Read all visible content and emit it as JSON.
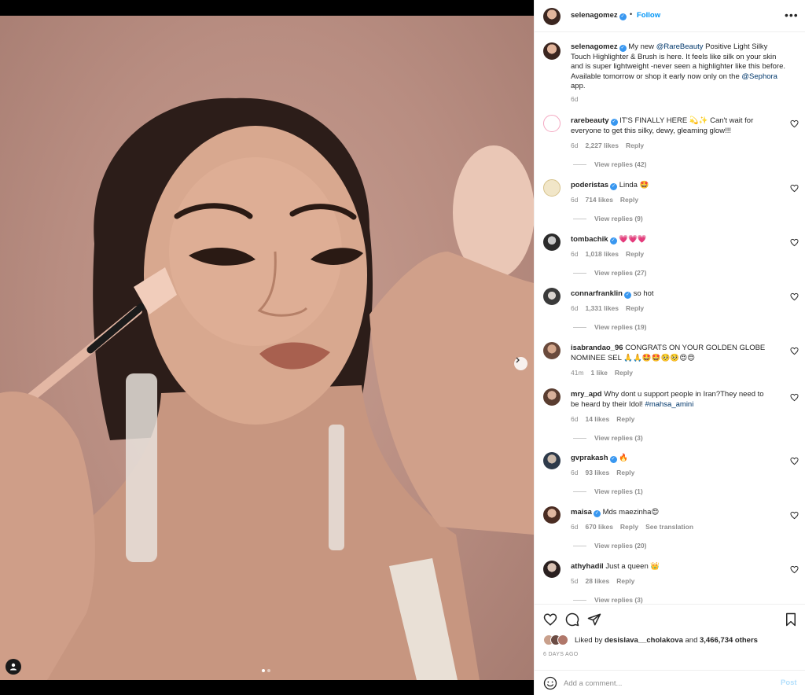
{
  "post": {
    "author": "selenagomez",
    "follow_label": "Follow",
    "more_label": "•••",
    "dot": "•",
    "media_dots": 2,
    "media_active_dot": 0
  },
  "caption": {
    "username": "selenagomez",
    "parts": {
      "a": " My new ",
      "mention1": "@RareBeauty",
      "b": " Positive Light Silky Touch Highlighter & Brush is here. It feels like silk on your skin and is super lightweight -never seen a highlighter like this before. Available tomorrow or shop it early now only on the ",
      "mention2": "@Sephora",
      "c": " app."
    },
    "age": "6d"
  },
  "comments": [
    {
      "username": "rarebeauty",
      "verified": true,
      "text": "IT'S FINALLY HERE 💫✨ Can't wait for everyone to get this silky, dewy, gleaming glow!!!",
      "age": "6d",
      "likes": "2,227 likes",
      "reply": "Reply",
      "replies": "View replies (42)"
    },
    {
      "username": "poderistas",
      "verified": true,
      "text": "Linda 🤩",
      "age": "6d",
      "likes": "714 likes",
      "reply": "Reply",
      "replies": "View replies (9)"
    },
    {
      "username": "tombachik",
      "verified": true,
      "text": "💗💗💗",
      "age": "6d",
      "likes": "1,018 likes",
      "reply": "Reply",
      "replies": "View replies (27)"
    },
    {
      "username": "connarfranklin",
      "verified": true,
      "text": "so hot",
      "age": "6d",
      "likes": "1,331 likes",
      "reply": "Reply",
      "replies": "View replies (19)"
    },
    {
      "username": "isabrandao_96",
      "verified": false,
      "text": "CONGRATS ON YOUR GOLDEN GLOBE NOMINEE SEL 🙏🙏🤩🤩🥺🥺😍😍",
      "age": "41m",
      "likes": "1 like",
      "reply": "Reply",
      "replies": ""
    },
    {
      "username": "mry_apd",
      "verified": false,
      "text_a": "Why dont u support people in Iran?They need to be heard by their Idol! ",
      "hashtag": "#mahsa_amini",
      "age": "6d",
      "likes": "14 likes",
      "reply": "Reply",
      "replies": "View replies (3)"
    },
    {
      "username": "gvprakash",
      "verified": true,
      "text": "🔥",
      "age": "6d",
      "likes": "93 likes",
      "reply": "Reply",
      "replies": "View replies (1)"
    },
    {
      "username": "maisa",
      "verified": true,
      "text": "Mds maezinha😍",
      "age": "6d",
      "likes": "670 likes",
      "reply": "Reply",
      "translate": "See translation",
      "replies": "View replies (20)"
    },
    {
      "username": "athyhadil",
      "verified": false,
      "text": "Just a queen 👑",
      "age": "5d",
      "likes": "28 likes",
      "reply": "Reply",
      "replies": "View replies (3)"
    }
  ],
  "likes": {
    "prefix": "Liked by ",
    "user": "desislava__cholakova",
    "middle": " and ",
    "count": "3,466,734 others"
  },
  "post_age": "6 DAYS AGO",
  "add_comment": {
    "placeholder": "Add a comment...",
    "post_label": "Post"
  },
  "colors": {
    "link": "#0095f6",
    "mention": "#00376b",
    "verified": "#3897f0",
    "muted": "#8e8e8e",
    "backdrop": "#b88d81"
  },
  "icons": [
    "next-arrow-icon",
    "user-tag-icon",
    "more-icon",
    "verified-icon",
    "heart-icon",
    "comment-icon",
    "share-icon",
    "bookmark-icon",
    "emoji-icon"
  ]
}
